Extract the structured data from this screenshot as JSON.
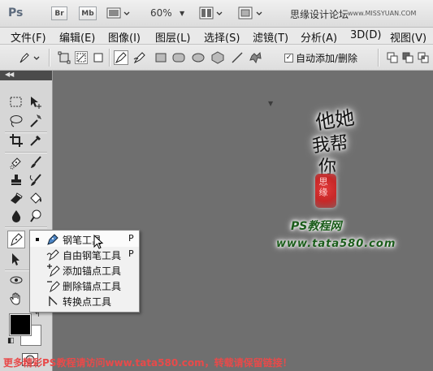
{
  "appbar": {
    "logo": "Ps",
    "bridge_label": "Br",
    "minibridge_label": "Mb",
    "zoom": "60%",
    "site_title": "思缘设计论坛",
    "site_url": "www.MISSYUAN.COM"
  },
  "menu": [
    "文件(F)",
    "编辑(E)",
    "图像(I)",
    "图层(L)",
    "选择(S)",
    "滤镜(T)",
    "分析(A)",
    "3D(D)",
    "视图(V)"
  ],
  "options": {
    "auto_add_delete_label": "自动添加/删除",
    "auto_add_delete_checked": true
  },
  "tools_panel": {
    "foreground_color": "#000000",
    "background_color": "#ffffff"
  },
  "flyout": {
    "items": [
      {
        "label": "钢笔工具",
        "shortcut": "P",
        "icon": "pen-icon"
      },
      {
        "label": "自由钢笔工具",
        "shortcut": "P",
        "icon": "freeform-pen-icon"
      },
      {
        "label": "添加锚点工具",
        "shortcut": "",
        "icon": "add-anchor-point-icon"
      },
      {
        "label": "删除锚点工具",
        "shortcut": "",
        "icon": "delete-anchor-point-icon"
      },
      {
        "label": "转换点工具",
        "shortcut": "",
        "icon": "convert-point-icon"
      }
    ]
  },
  "artwork": {
    "calligraphy_1": "他她",
    "calligraphy_2": "我帮",
    "calligraphy_3": "你",
    "seal_text": "思缘",
    "site_name": "PS教程网",
    "site_url": "www.tata580.com"
  },
  "footer_note": "更多精彩PS教程请访问www.tata580.com，转载请保留链接！",
  "colors": {
    "canvas": "#6f6f6f",
    "panel": "#d6d6d6",
    "watermark_green": "#1a5c1a",
    "seal_red": "#c82828",
    "footer_red": "#e84a4a"
  }
}
